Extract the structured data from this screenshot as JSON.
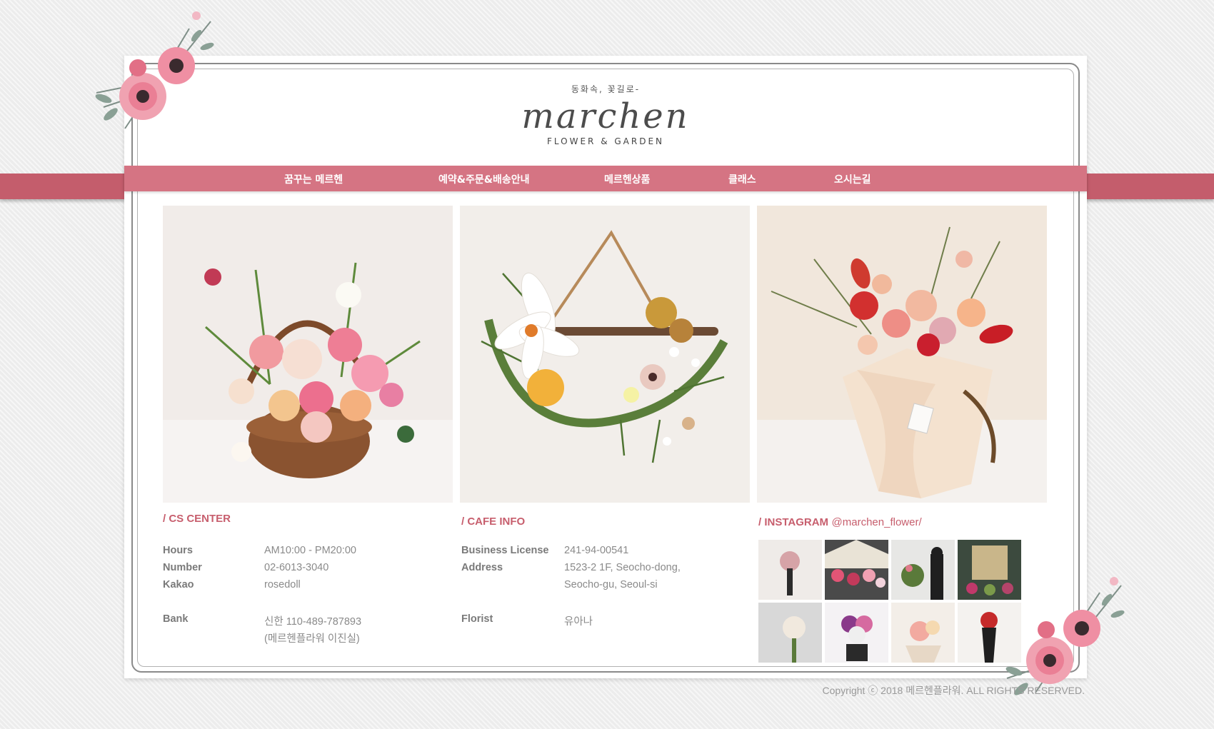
{
  "header": {
    "tagline": "동화속, 꽃길로-",
    "brand": "marchen",
    "brand_sub": "FLOWER & GARDEN"
  },
  "nav": {
    "items": [
      {
        "label": "꿈꾸는 메르헨"
      },
      {
        "label": "예약&주문&배송안내"
      },
      {
        "label": "메르헨상품"
      },
      {
        "label": "클래스"
      },
      {
        "label": "오시는길"
      }
    ]
  },
  "photos": [
    {
      "subject": "flower basket",
      "icon": "flower-basket-photo"
    },
    {
      "subject": "floral wreath",
      "icon": "wreath-photo"
    },
    {
      "subject": "bouquet",
      "icon": "bouquet-photo"
    }
  ],
  "cs_center": {
    "title": "/ CS CENTER",
    "rows": [
      {
        "label": "Hours",
        "value": "AM10:00 - PM20:00"
      },
      {
        "label": "Number",
        "value": "02-6013-3040"
      },
      {
        "label": "Kakao",
        "value": "rosedoll"
      },
      {
        "label": "Bank",
        "value": "신한 110-489-787893",
        "value2": "(메르헨플라워 이진실)"
      }
    ]
  },
  "cafe_info": {
    "title": "/ CAFE INFO",
    "rows": [
      {
        "label": "Business License",
        "value": "241-94-00541"
      },
      {
        "label": "Address",
        "value": "1523-2 1F, Seocho-dong,",
        "value2": "Seocho-gu, Seoul-si"
      },
      {
        "label": "Florist",
        "value": "유아나"
      }
    ]
  },
  "instagram": {
    "title": "/ INSTAGRAM",
    "handle": "@marchen_flower/"
  },
  "footer": {
    "copyright": "Copyright ⓒ 2018 메르헨플라워. ALL RIGHTS RESERVED."
  },
  "colors": {
    "accent": "#c75e6d",
    "nav_bg": "#d57483",
    "ribbon": "#c45d6c"
  }
}
